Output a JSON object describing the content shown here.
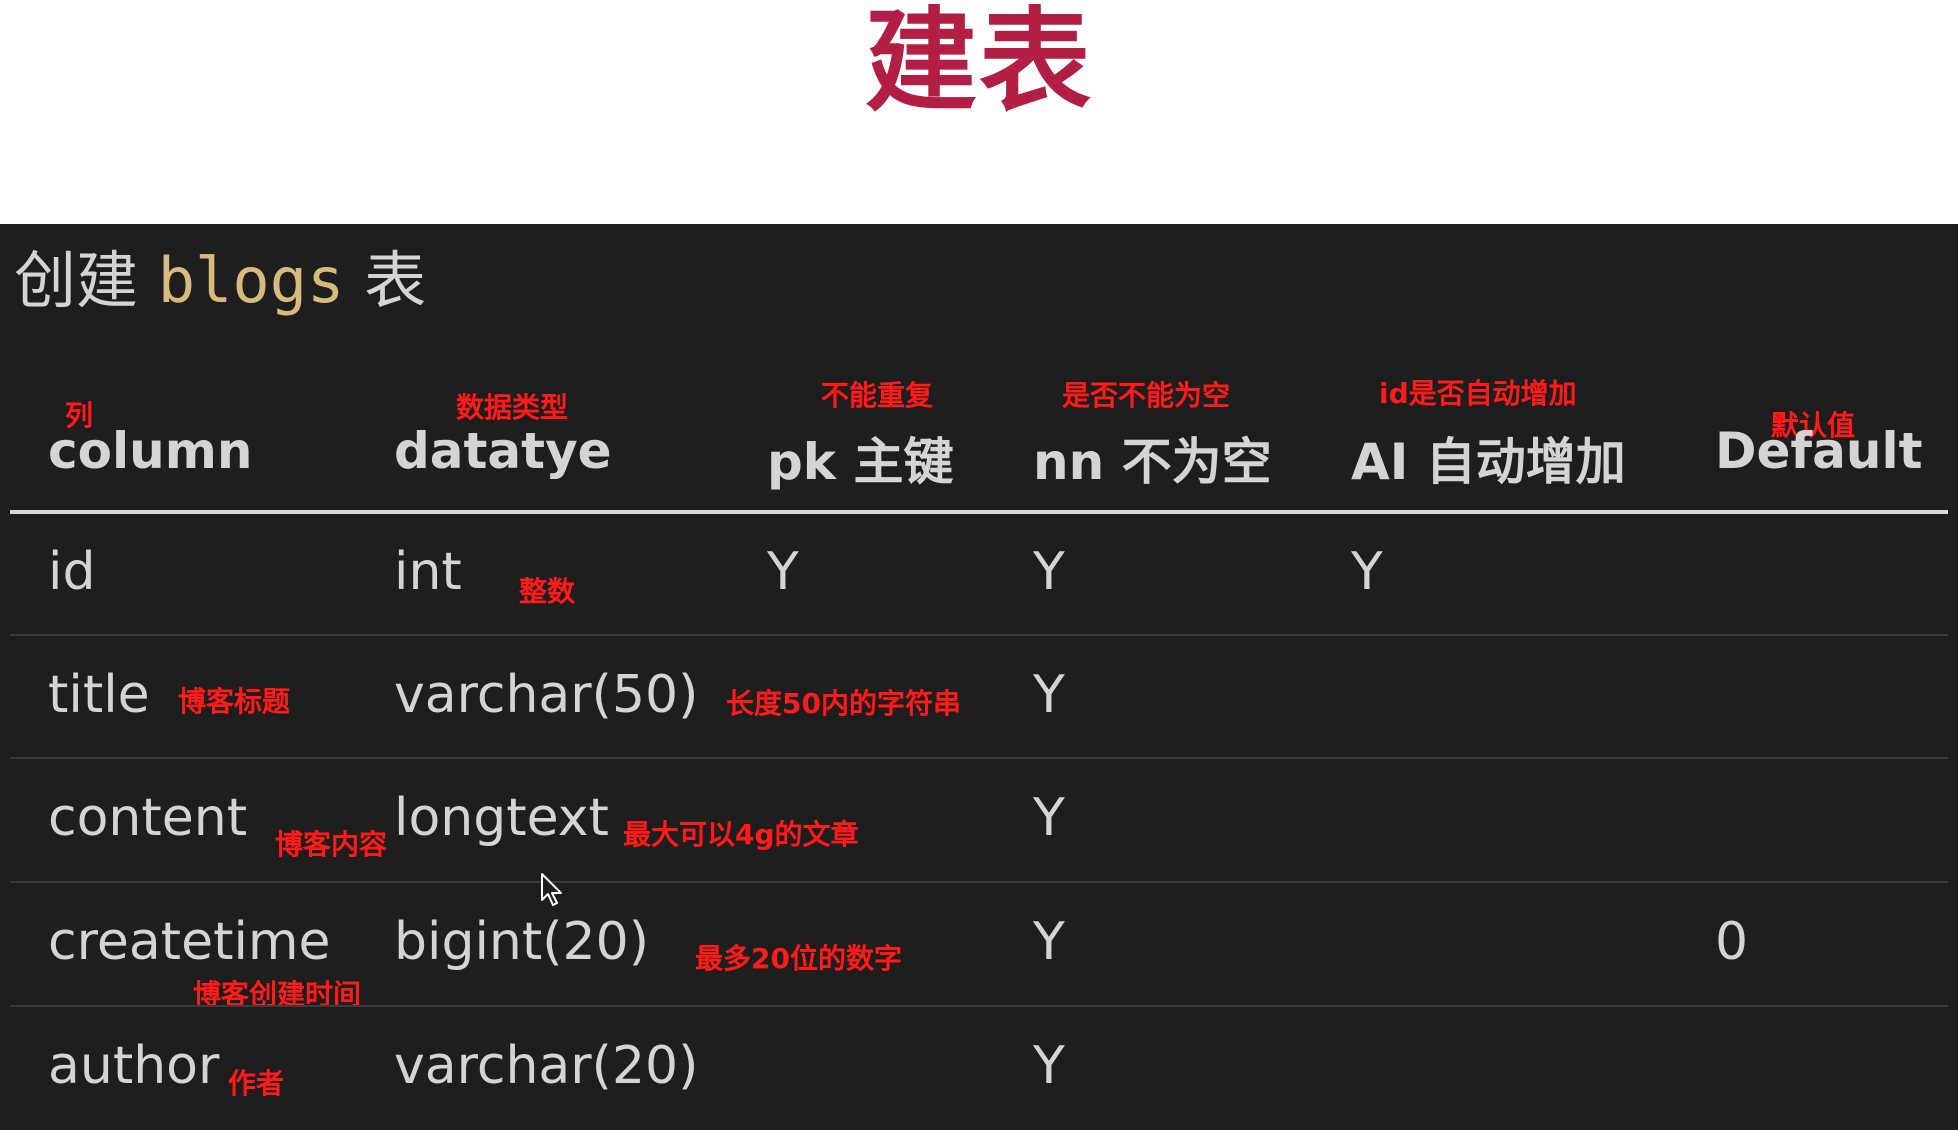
{
  "slide": {
    "title": "建表"
  },
  "panel": {
    "heading_prefix": "创建 ",
    "heading_table": "blogs",
    "heading_suffix": " 表"
  },
  "headers": [
    {
      "label": "column",
      "note": "列"
    },
    {
      "label": "datatye",
      "note": "数据类型"
    },
    {
      "label": "pk 主键",
      "note": "不能重复"
    },
    {
      "label": "nn 不为空",
      "note": "是否不能为空"
    },
    {
      "label": "AI 自动增加",
      "note": "id是否自动增加"
    },
    {
      "label": "Default",
      "note": "默认值"
    }
  ],
  "rows": [
    {
      "column": "id",
      "column_note": "",
      "datatype": "int",
      "datatype_note": "整数",
      "pk": "Y",
      "nn": "Y",
      "ai": "Y",
      "default": ""
    },
    {
      "column": "title",
      "column_note": "博客标题",
      "datatype": "varchar(50)",
      "datatype_note": "长度50内的字符串",
      "pk": "",
      "nn": "Y",
      "ai": "",
      "default": ""
    },
    {
      "column": "content",
      "column_note": "博客内容",
      "datatype": "longtext",
      "datatype_note": "最大可以4g的文章",
      "pk": "",
      "nn": "Y",
      "ai": "",
      "default": ""
    },
    {
      "column": "createtime",
      "column_note": "博客创建时间",
      "datatype": "bigint(20)",
      "datatype_note": "最多20位的数字",
      "pk": "",
      "nn": "Y",
      "ai": "",
      "default": "0"
    },
    {
      "column": "author",
      "column_note": "作者",
      "datatype": "varchar(20)",
      "datatype_note": "",
      "pk": "",
      "nn": "Y",
      "ai": "",
      "default": ""
    }
  ],
  "icons": {
    "cursor": "mouse-pointer-icon"
  }
}
